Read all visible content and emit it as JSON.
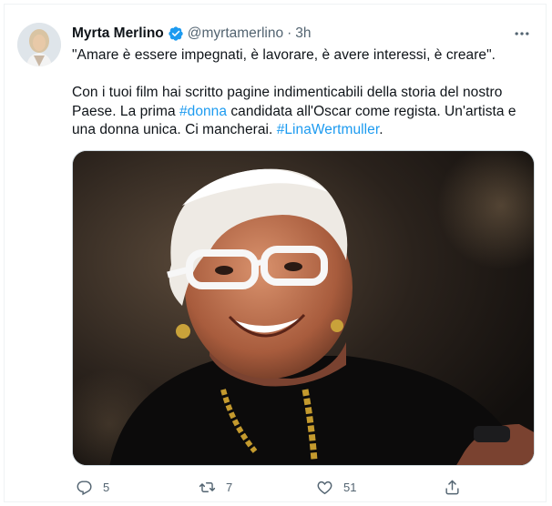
{
  "tweet": {
    "author_name": "Myrta Merlino",
    "handle": "@myrtamerlino",
    "separator": "·",
    "time": "3h",
    "quote": "\"Amare è essere impegnati, è lavorare, è avere interessi, è creare\".",
    "body_part1": "Con i tuoi film hai scritto pagine indimenticabili della storia del nostro Paese. La prima ",
    "hashtag1": "#donna",
    "body_part2": " candidata all'Oscar come regista. Un'artista e una donna unica. Ci mancherai. ",
    "hashtag2": "#LinaWertmuller",
    "body_part3": ".",
    "verified": true,
    "accent_color": "#1d9bf0"
  },
  "actions": {
    "replies": "5",
    "retweets": "7",
    "likes": "51"
  },
  "icons": {
    "avatar": "avatar",
    "verified": "verified-badge-icon",
    "more": "more-options-icon",
    "reply": "reply-icon",
    "retweet": "retweet-icon",
    "like": "heart-icon",
    "share": "share-icon"
  }
}
